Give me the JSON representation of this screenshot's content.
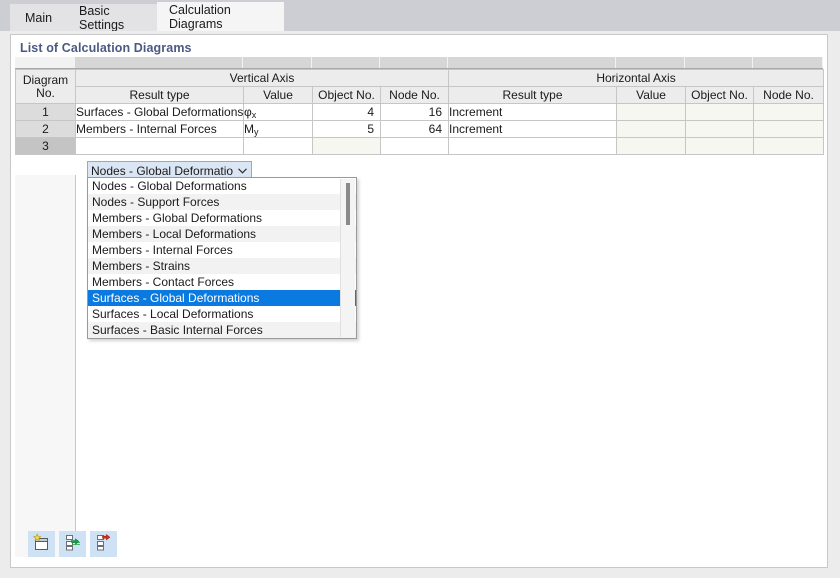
{
  "tabs": [
    {
      "label": "Main",
      "active": false
    },
    {
      "label": "Basic Settings",
      "active": false
    },
    {
      "label": "Calculation Diagrams",
      "active": true
    }
  ],
  "panel": {
    "title": "List of Calculation Diagrams"
  },
  "table": {
    "corner_header_line1": "Diagram",
    "corner_header_line2": "No.",
    "groups": [
      {
        "label": "Vertical Axis"
      },
      {
        "label": "Horizontal Axis"
      }
    ],
    "columns": [
      "Result type",
      "Value",
      "Object No.",
      "Node No.",
      "Result type",
      "Value",
      "Object No.",
      "Node No."
    ],
    "rows": [
      {
        "no": "1",
        "v_result_type": "Surfaces - Global Deformations",
        "v_value": "φ",
        "v_value_sub": "x",
        "v_object_no": "4",
        "v_node_no": "16",
        "h_result_type": "Increment",
        "h_value": "",
        "h_object_no": "",
        "h_node_no": ""
      },
      {
        "no": "2",
        "v_result_type": "Members - Internal Forces",
        "v_value": "M",
        "v_value_sub": "y",
        "v_object_no": "5",
        "v_node_no": "64",
        "h_result_type": "Increment",
        "h_value": "",
        "h_object_no": "",
        "h_node_no": ""
      },
      {
        "no": "3",
        "v_result_type": "",
        "v_value": "",
        "v_value_sub": "",
        "v_object_no": "",
        "v_node_no": "",
        "h_result_type": "",
        "h_value": "",
        "h_object_no": "",
        "h_node_no": ""
      }
    ]
  },
  "combo": {
    "value": "Nodes - Global Deformatio...",
    "arrow_icon": "chevron-down-icon"
  },
  "dropdown": {
    "selected_index": 7,
    "items": [
      "Nodes - Global Deformations",
      "Nodes - Support Forces",
      "Members - Global Deformations",
      "Members - Local Deformations",
      "Members - Internal Forces",
      "Members - Strains",
      "Members - Contact Forces",
      "Surfaces - Global Deformations",
      "Surfaces - Local Deformations",
      "Surfaces - Basic Internal Forces"
    ]
  },
  "toolbar": {
    "buttons": [
      {
        "name": "new-diagram-button",
        "icon": "new-window-icon"
      },
      {
        "name": "insert-row-button",
        "icon": "insert-row-icon"
      },
      {
        "name": "delete-row-button",
        "icon": "delete-row-icon"
      }
    ]
  },
  "colors": {
    "accent": "#0a7ae0",
    "panel_title": "#4a5a82",
    "readonly_cell": "#f5f7f0",
    "toolbar_button": "#cfe2f5"
  }
}
